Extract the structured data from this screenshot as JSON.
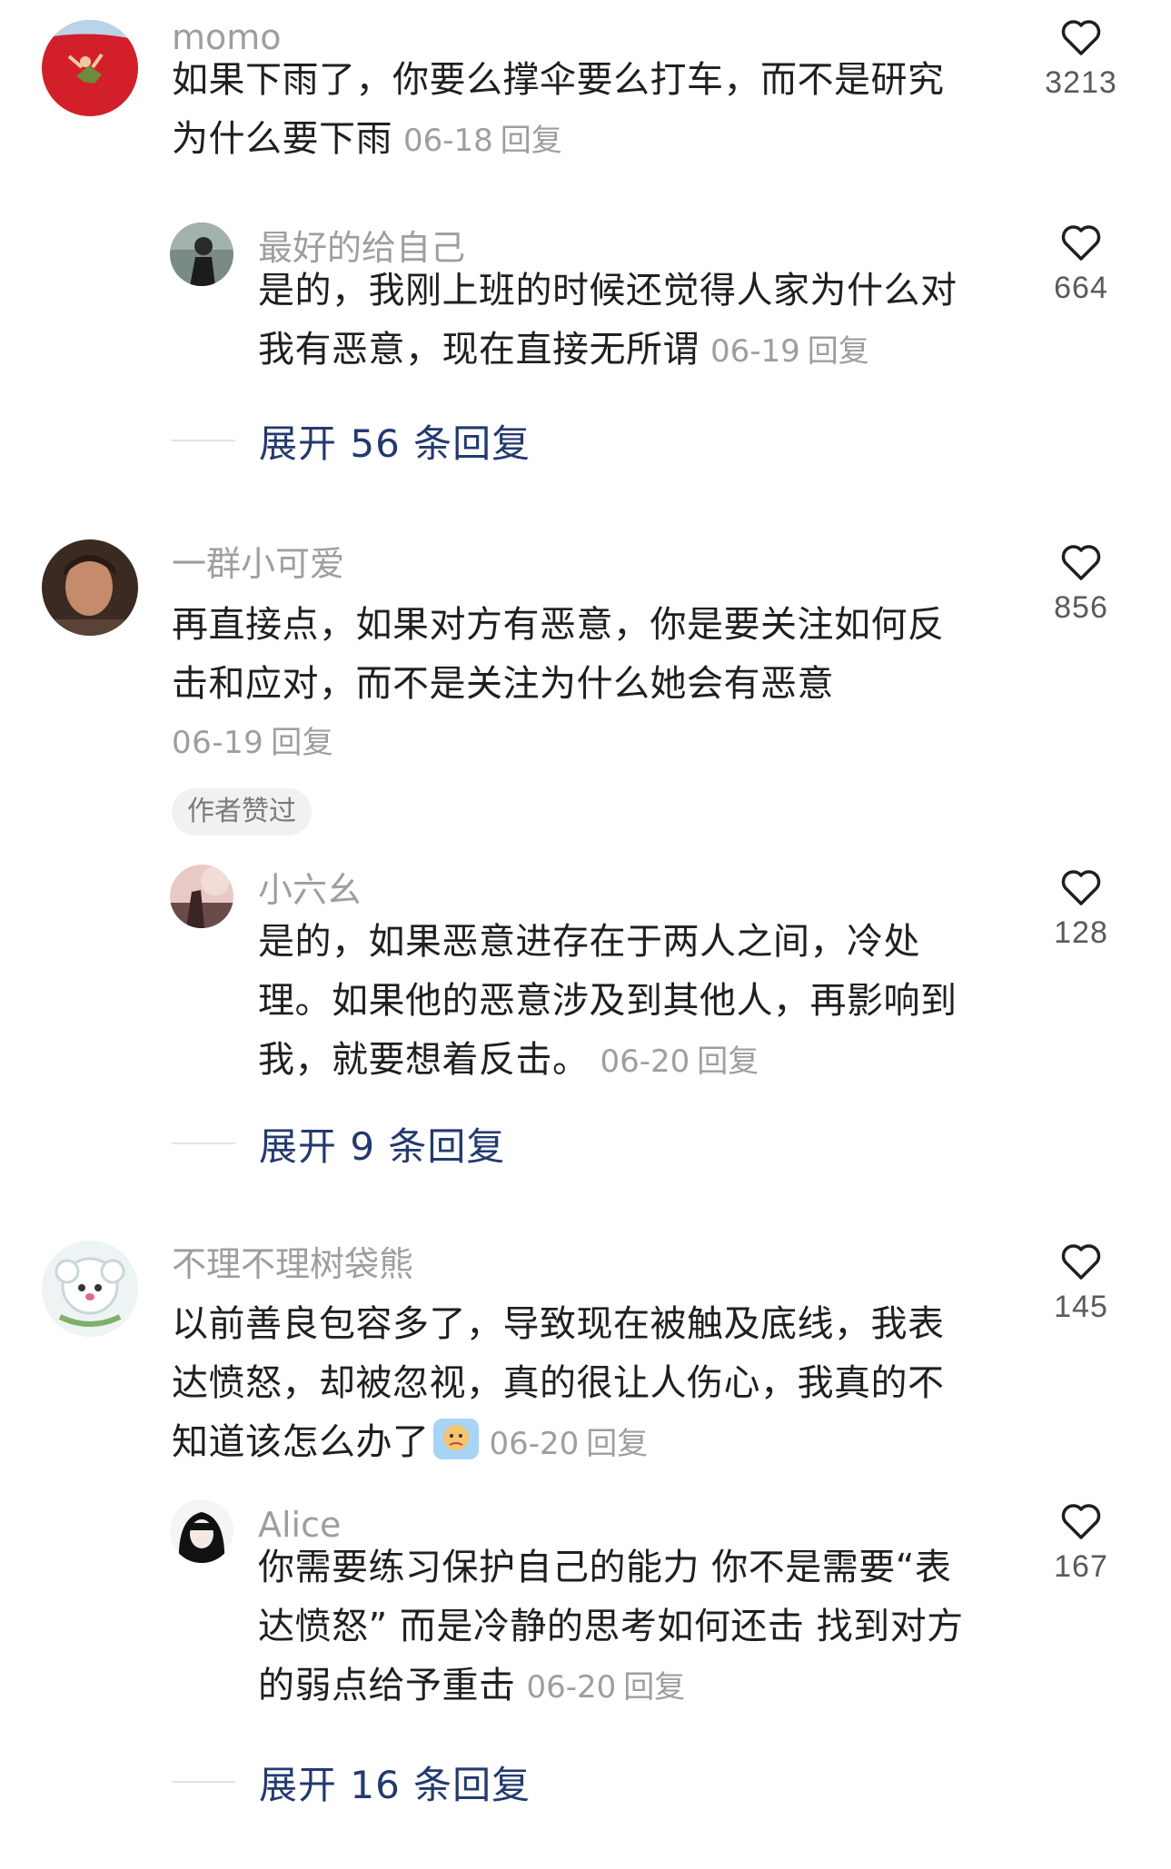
{
  "comments": [
    {
      "username": "momo",
      "lines": [
        "如果下雨了，你要么撑伞要么打车，而不是研究",
        "为什么要下雨"
      ],
      "date": "06-18",
      "reply_label": "回复",
      "likes": "3213",
      "avatar_icon": "avatar-red-circle",
      "reply": {
        "username": "最好的给自己",
        "lines": [
          "是的，我刚上班的时候还觉得人家为什么对",
          "我有恶意，现在直接无所谓"
        ],
        "date": "06-19",
        "reply_label": "回复",
        "likes": "664"
      },
      "expand_label": "展开 56 条回复"
    },
    {
      "username": "一群小可爱",
      "lines": [
        "再直接点，如果对方有恶意，你是要关注如何反",
        "击和应对，而不是关注为什么她会有恶意"
      ],
      "date": "06-19",
      "reply_label": "回复",
      "likes": "856",
      "author_badge": "作者赞过",
      "reply": {
        "username": "小六幺",
        "lines": [
          "是的，如果恶意进存在于两人之间，冷处",
          "理。如果他的恶意涉及到其他人，再影响到",
          "我，就要想着反击。"
        ],
        "date": "06-20",
        "reply_label": "回复",
        "likes": "128"
      },
      "expand_label": "展开 9 条回复"
    },
    {
      "username": "不理不理树袋熊",
      "lines": [
        "以前善良包容多了，导致现在被触及底线，我表",
        "达愤怒，却被忽视，真的很让人伤心，我真的不",
        "知道该怎么办了"
      ],
      "date": "06-20",
      "reply_label": "回复",
      "likes": "145",
      "emoji": "crying-face-emoji",
      "reply": {
        "username": "Alice",
        "lines": [
          "你需要练习保护自己的能力 你不是需要“表",
          "达愤怒” 而是冷静的思考如何还击 找到对方",
          "的弱点给予重击"
        ],
        "date": "06-20",
        "reply_label": "回复",
        "likes": "167"
      },
      "expand_label": "展开 16 条回复"
    }
  ],
  "colors": {
    "username": "#9e9e9e",
    "text": "#1f1f1f",
    "expand": "#233a6e",
    "heart": "#1f1f1f"
  }
}
